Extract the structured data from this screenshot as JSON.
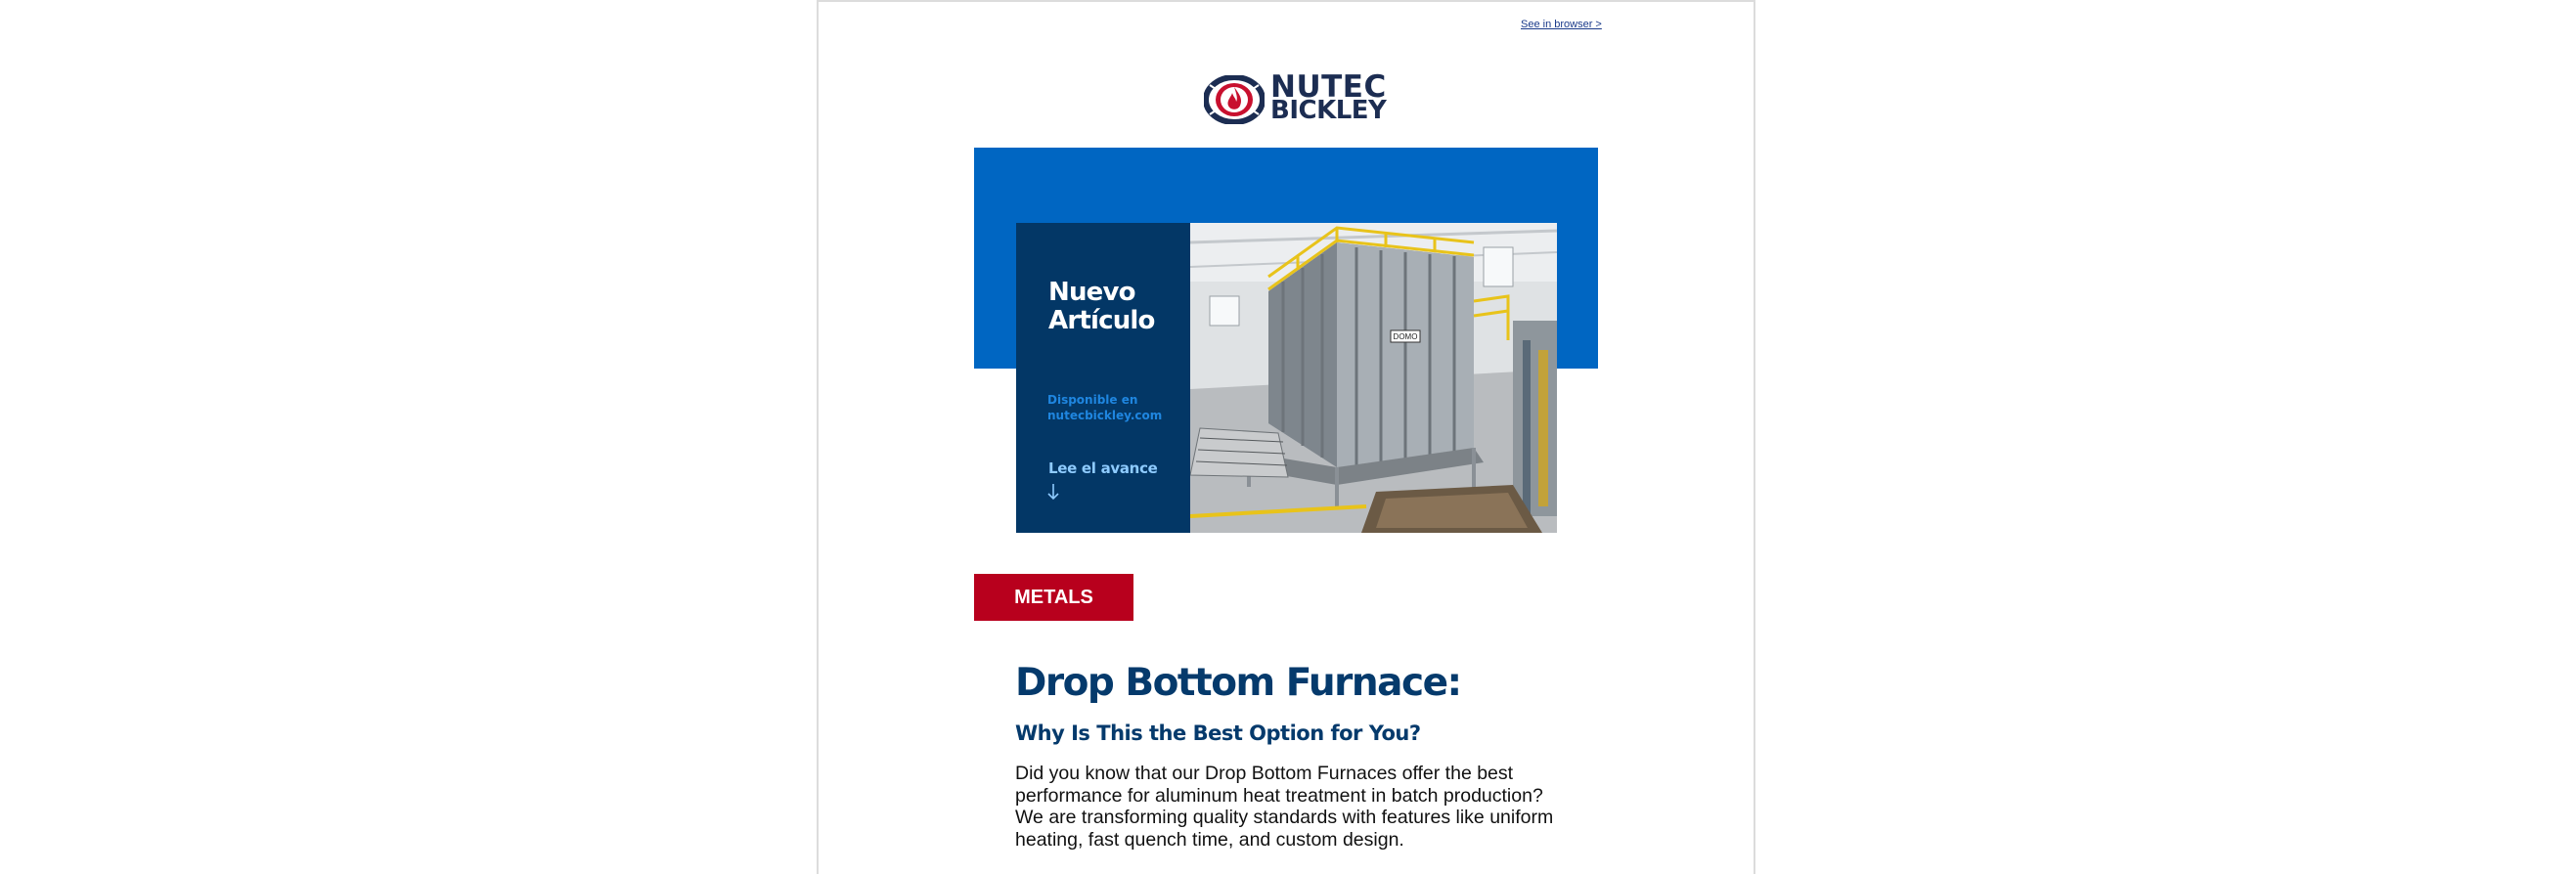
{
  "header": {
    "see_in_browser": "See in browser >"
  },
  "logo": {
    "line1": "NUTEC",
    "line2": "BICKLEY"
  },
  "hero": {
    "title": "Nuevo Artículo",
    "availability": "Disponible en nutecbickley.com",
    "read_more": "Lee el avance",
    "arrow_icon": "arrow-down-icon",
    "photo_label": "DOMO"
  },
  "tag": {
    "label": "METALS"
  },
  "article": {
    "title": "Drop Bottom Furnace:",
    "subtitle": "Why Is This the Best Option for You?",
    "body": "Did you know that our Drop Bottom Furnaces offer the best performance for aluminum heat treatment in batch production? We are transforming quality standards with features like uniform heating, fast quench time, and custom design."
  },
  "colors": {
    "brand_navy": "#053a6c",
    "brand_blue": "#0066c2",
    "brand_red": "#b8001d",
    "hero_dark": "#033766"
  }
}
